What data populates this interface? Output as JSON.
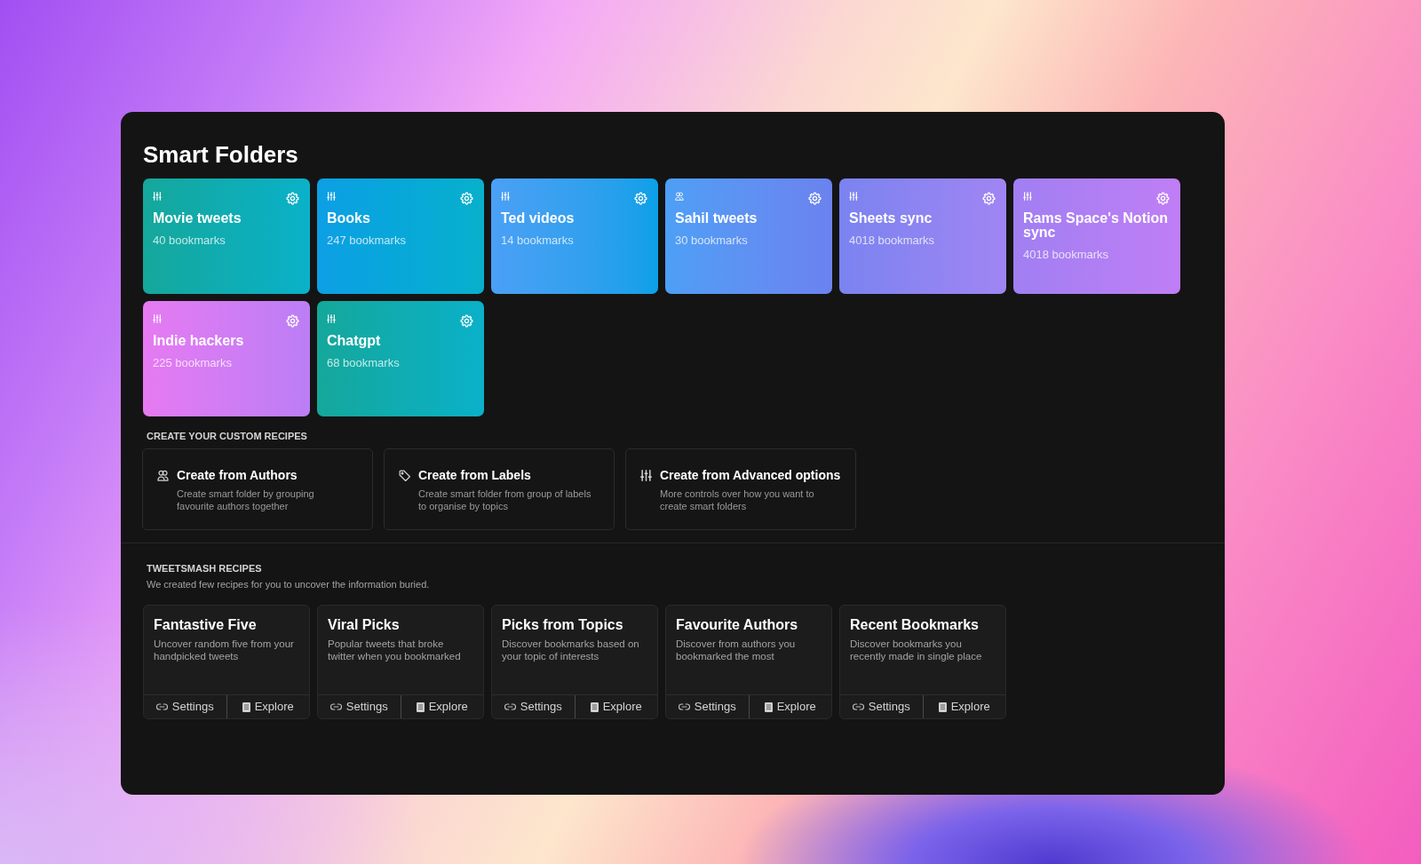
{
  "title": "Smart Folders",
  "smart_folders": [
    {
      "name": "Movie tweets",
      "count": "40 bookmarks",
      "kind": "advanced"
    },
    {
      "name": "Books",
      "count": "247 bookmarks",
      "kind": "advanced"
    },
    {
      "name": "Ted videos",
      "count": "14 bookmarks",
      "kind": "advanced"
    },
    {
      "name": "Sahil tweets",
      "count": "30 bookmarks",
      "kind": "authors"
    },
    {
      "name": "Sheets sync",
      "count": "4018 bookmarks",
      "kind": "advanced"
    },
    {
      "name": "Rams Space's Notion sync",
      "count": "4018 bookmarks",
      "kind": "advanced"
    },
    {
      "name": "Indie hackers",
      "count": "225 bookmarks",
      "kind": "advanced"
    },
    {
      "name": "Chatgpt",
      "count": "68 bookmarks",
      "kind": "advanced"
    }
  ],
  "custom_recipes": {
    "heading": "CREATE YOUR CUSTOM RECIPES",
    "items": [
      {
        "kind": "authors",
        "title": "Create from Authors",
        "description": "Create smart folder by grouping favourite authors together"
      },
      {
        "kind": "labels",
        "title": "Create from Labels",
        "description": "Create smart folder from group of labels to organise by topics"
      },
      {
        "kind": "advanced",
        "title": "Create from Advanced options",
        "description": "More controls over how you want to create smart folders"
      }
    ]
  },
  "tweetsmash_recipes": {
    "heading": "TWEETSMASH RECIPES",
    "description": "We created few recipes for you to uncover the information buried.",
    "items": [
      {
        "title": "Fantastive Five",
        "description": "Uncover random five from your handpicked tweets",
        "actions": [
          {
            "kind": "settings",
            "label": "Settings"
          },
          {
            "kind": "explore",
            "label": "Explore"
          }
        ]
      },
      {
        "title": "Viral Picks",
        "description": "Popular tweets that broke twitter when you bookmarked",
        "actions": [
          {
            "kind": "settings",
            "label": "Settings"
          },
          {
            "kind": "explore",
            "label": "Explore"
          }
        ]
      },
      {
        "title": "Picks from Topics",
        "description": "Discover bookmarks based on your topic of interests",
        "actions": [
          {
            "kind": "settings",
            "label": "Settings"
          },
          {
            "kind": "explore",
            "label": "Explore"
          }
        ]
      },
      {
        "title": "Favourite Authors",
        "description": "Discover from authors you bookmarked the most",
        "actions": [
          {
            "kind": "settings",
            "label": "Settings"
          },
          {
            "kind": "explore",
            "label": "Explore"
          }
        ]
      },
      {
        "title": "Recent Bookmarks",
        "description": "Discover bookmarks you recently made in single place",
        "actions": [
          {
            "kind": "settings",
            "label": "Settings"
          },
          {
            "kind": "explore",
            "label": "Explore"
          }
        ]
      }
    ]
  }
}
